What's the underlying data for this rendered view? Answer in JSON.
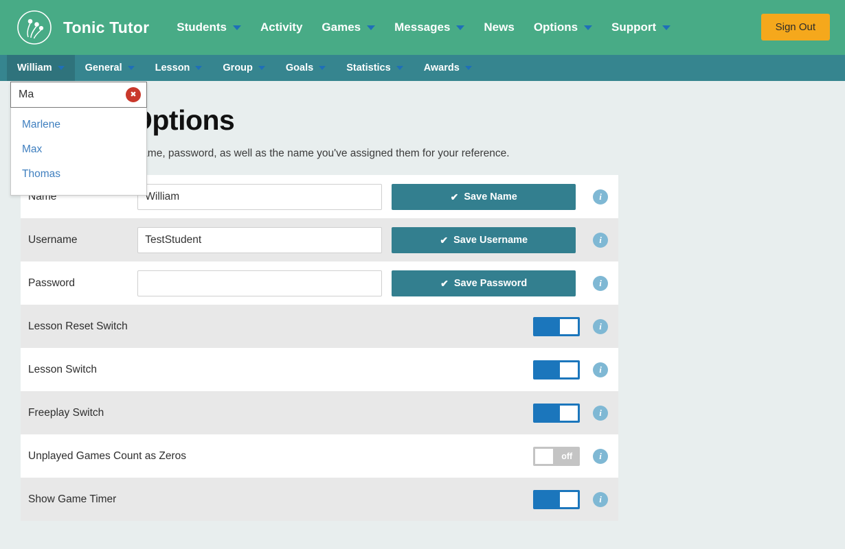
{
  "header": {
    "brand": "Tonic Tutor",
    "logo_icon": "tonic-tutor-logo",
    "signout_label": "Sign Out",
    "nav": [
      {
        "label": "Students",
        "has_caret": true
      },
      {
        "label": "Activity",
        "has_caret": false
      },
      {
        "label": "Games",
        "has_caret": true
      },
      {
        "label": "Messages",
        "has_caret": true
      },
      {
        "label": "News",
        "has_caret": false
      },
      {
        "label": "Options",
        "has_caret": true
      },
      {
        "label": "Support",
        "has_caret": true
      }
    ]
  },
  "subnav": {
    "items": [
      {
        "label": "William",
        "has_caret": true,
        "active": true
      },
      {
        "label": "General",
        "has_caret": true,
        "active": false
      },
      {
        "label": "Lesson",
        "has_caret": true,
        "active": false
      },
      {
        "label": "Group",
        "has_caret": true,
        "active": false
      },
      {
        "label": "Goals",
        "has_caret": true,
        "active": false
      },
      {
        "label": "Statistics",
        "has_caret": true,
        "active": false
      },
      {
        "label": "Awards",
        "has_caret": true,
        "active": false
      }
    ]
  },
  "student_dropdown": {
    "search_value": "Ma",
    "search_placeholder": "",
    "clear_icon": "close-icon",
    "clear_glyph": "✖",
    "results": [
      {
        "label": "Marlene"
      },
      {
        "label": "Max"
      },
      {
        "label": "Thomas"
      }
    ]
  },
  "page": {
    "title": "Student Options",
    "description": "Change a student's username, password, as well as the name you've assigned them for your reference."
  },
  "options": {
    "check_glyph": "✔",
    "info_glyph": "i",
    "off_text": "off",
    "fields": [
      {
        "label": "Name",
        "type": "text",
        "value": "William",
        "placeholder": "",
        "button_label": "Save Name",
        "info_icon": "info-icon"
      },
      {
        "label": "Username",
        "type": "text",
        "value": "TestStudent",
        "placeholder": "",
        "button_label": "Save Username",
        "info_icon": "info-icon"
      },
      {
        "label": "Password",
        "type": "text",
        "value": "",
        "placeholder": "",
        "button_label": "Save Password",
        "info_icon": "info-icon"
      },
      {
        "label": "Lesson Reset Switch",
        "type": "toggle",
        "state": "on",
        "info_icon": "info-icon"
      },
      {
        "label": "Lesson Switch",
        "type": "toggle",
        "state": "on",
        "info_icon": "info-icon"
      },
      {
        "label": "Freeplay Switch",
        "type": "toggle",
        "state": "on",
        "info_icon": "info-icon"
      },
      {
        "label": "Unplayed Games Count as Zeros",
        "type": "toggle",
        "state": "off",
        "info_icon": "info-icon"
      },
      {
        "label": "Show Game Timer",
        "type": "toggle",
        "state": "on",
        "info_icon": "info-icon"
      }
    ]
  },
  "colors": {
    "header_green": "#48ab86",
    "subnav_teal": "#36858f",
    "subnav_active": "#2f737c",
    "signout_orange": "#f5a81c",
    "save_teal": "#337f8f",
    "toggle_on_blue": "#1b76bc",
    "toggle_off_gray": "#c4c4c4",
    "info_blue": "#7fb8d4",
    "clear_red": "#c9382b",
    "link_blue": "#3f7fbf",
    "page_bg": "#e8eeee"
  }
}
